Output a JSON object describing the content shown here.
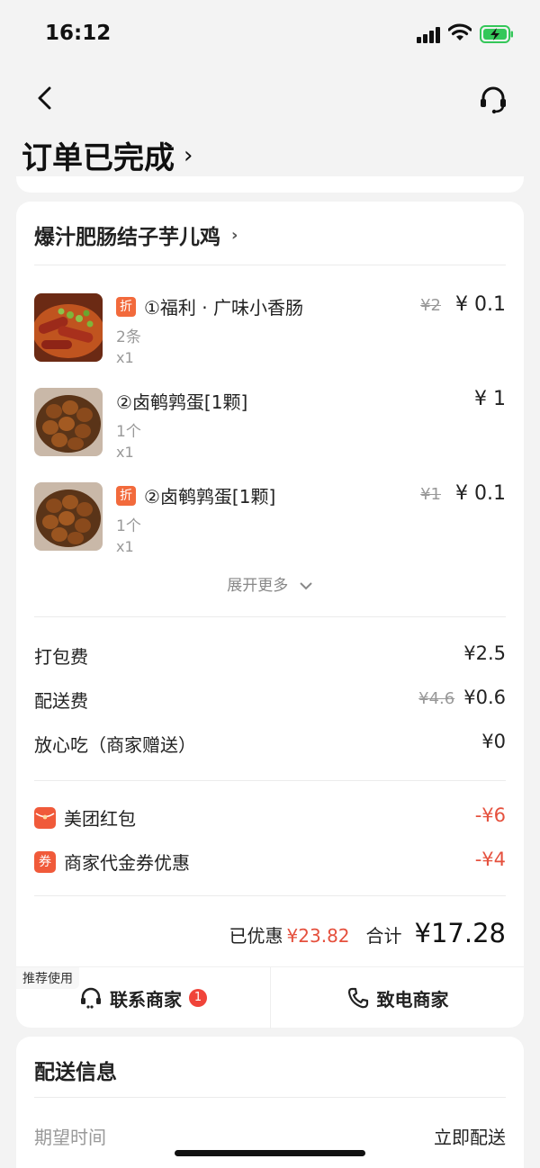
{
  "status_bar": {
    "time": "16:12"
  },
  "header": {
    "title": "订单已完成",
    "title_chevron": "›"
  },
  "order": {
    "shop_name": "爆汁肥肠结子芋儿鸡",
    "shop_chevron": "›",
    "items": [
      {
        "badge": "折",
        "name": "①福利 · 广味小香肠",
        "spec": "2条",
        "qty": "x1",
        "original_price": "¥2",
        "price": "¥ 0.1"
      },
      {
        "badge": "",
        "name": "②卤鹌鹑蛋[1颗]",
        "spec": "1个",
        "qty": "x1",
        "original_price": "",
        "price": "¥ 1"
      },
      {
        "badge": "折",
        "name": "②卤鹌鹑蛋[1颗]",
        "spec": "1个",
        "qty": "x1",
        "original_price": "¥1",
        "price": "¥ 0.1"
      }
    ],
    "expand_more": "展开更多",
    "fees": [
      {
        "label": "打包费",
        "original": "",
        "value": "¥2.5"
      },
      {
        "label": "配送费",
        "original": "¥4.6",
        "value": "¥0.6"
      },
      {
        "label": "放心吃（商家赠送）",
        "original": "",
        "value": "¥0"
      }
    ],
    "discounts": [
      {
        "icon_text": "",
        "label": "美团红包",
        "value": "-¥6"
      },
      {
        "icon_text": "券",
        "label": "商家代金券优惠",
        "value": "-¥4"
      }
    ],
    "summary": {
      "saved_label": "已优惠",
      "saved_value": "¥23.82",
      "total_label": "合计",
      "total_value": "¥17.28"
    },
    "actions": {
      "recommend_tag": "推荐使用",
      "contact_label": "联系商家",
      "contact_unread": "1",
      "call_label": "致电商家"
    }
  },
  "delivery": {
    "title": "配送信息",
    "expected_time_label": "期望时间",
    "expected_time_value": "立即配送"
  },
  "colors": {
    "accent_red": "#e5503d",
    "badge_orange": "#f26a3c"
  },
  "icons": [
    "back-icon",
    "customer-service-icon",
    "headset-icon",
    "phone-icon",
    "red-packet-icon",
    "coupon-icon",
    "chevron-down-icon"
  ]
}
